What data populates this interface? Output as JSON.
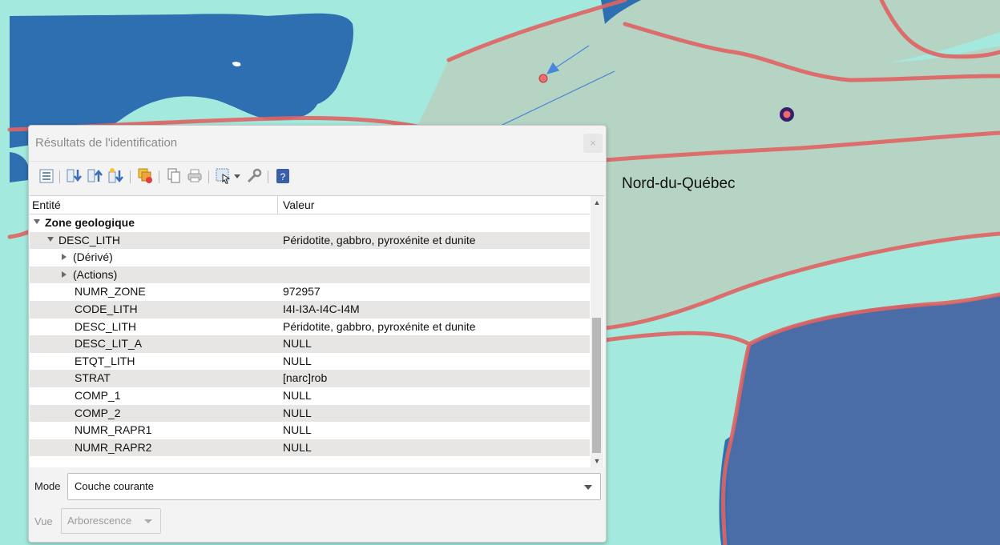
{
  "map": {
    "region_label": "Nord-du-Québec",
    "colors": {
      "water": "#2e6fb1",
      "land": "#a3e9dd",
      "zone": "#b5d4c4",
      "deep_zone": "#4a6da8",
      "boundary": "#e06363",
      "arrow": "#4a86d9",
      "marker_fill": "#f06b6b",
      "marker_ring": "#3a1e6b"
    }
  },
  "dialog": {
    "title": "Résultats de l'identification",
    "close_glyph": "×",
    "toolbar": {
      "icons": [
        "expand-tree-icon",
        "expand-all-icon",
        "collapse-all-icon",
        "expand-new-icon",
        "clear-results-icon",
        "copy-icon",
        "print-icon",
        "select-features-icon",
        "dropdown-arrow-icon",
        "settings-wrench-icon",
        "help-icon"
      ]
    },
    "columns": {
      "entity": "Entité",
      "value": "Valeur"
    },
    "tree": [
      {
        "field": "Zone geologique",
        "value": "",
        "expander": "open",
        "bold": true
      },
      {
        "field": "DESC_LITH",
        "value": "Péridotite, gabbro, pyroxénite et dunite",
        "expander": "open"
      },
      {
        "field": "(Dérivé)",
        "value": "",
        "expander": "closed"
      },
      {
        "field": "(Actions)",
        "value": "",
        "expander": "closed"
      },
      {
        "field": "NUMR_ZONE",
        "value": "972957"
      },
      {
        "field": "CODE_LITH",
        "value": "I4I-I3A-I4C-I4M"
      },
      {
        "field": "DESC_LITH",
        "value": "Péridotite, gabbro, pyroxénite et dunite"
      },
      {
        "field": "DESC_LIT_A",
        "value": "NULL"
      },
      {
        "field": "ETQT_LITH",
        "value": "NULL"
      },
      {
        "field": "STRAT",
        "value": "[narc]rob"
      },
      {
        "field": "COMP_1",
        "value": "NULL"
      },
      {
        "field": "COMP_2",
        "value": "NULL"
      },
      {
        "field": "NUMR_RAPR1",
        "value": "NULL"
      },
      {
        "field": "NUMR_RAPR2",
        "value": "NULL"
      }
    ],
    "scroll": {
      "up_glyph": "▲",
      "down_glyph": "▼"
    },
    "mode": {
      "label": "Mode",
      "value": "Couche courante"
    },
    "view": {
      "label": "Vue",
      "value": "Arborescence"
    }
  }
}
